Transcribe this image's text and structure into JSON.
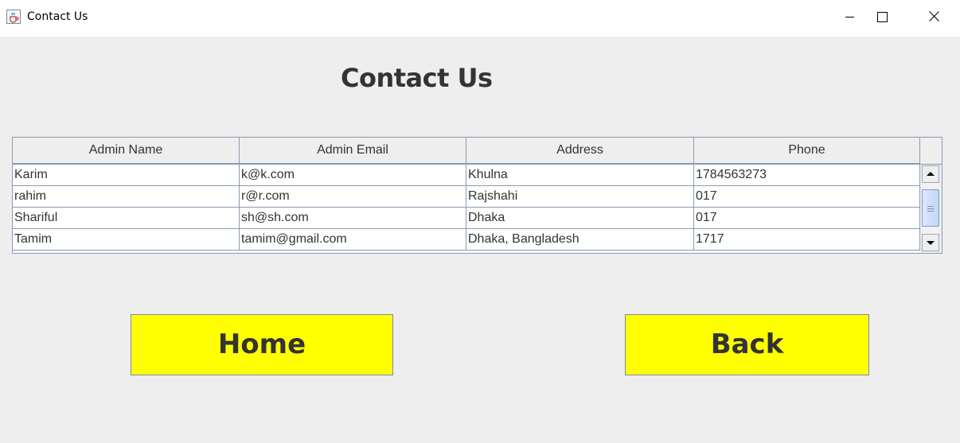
{
  "window": {
    "title": "Contact Us",
    "icons": {
      "app": "java-coffee-cup-icon",
      "minimize": "minimize-icon",
      "maximize": "maximize-icon",
      "close": "close-icon"
    }
  },
  "page": {
    "heading": "Contact Us"
  },
  "table": {
    "columns": [
      "Admin Name",
      "Admin Email",
      "Address",
      "Phone"
    ],
    "rows": [
      [
        "Karim",
        "k@k.com",
        "Khulna",
        "1784563273"
      ],
      [
        "rahim",
        "r@r.com",
        "Rajshahi",
        "017"
      ],
      [
        "Shariful",
        "sh@sh.com",
        "Dhaka",
        "017"
      ],
      [
        "Tamim",
        "tamim@gmail.com",
        "Dhaka, Bangladesh",
        "1717"
      ]
    ],
    "scrollbar": {
      "up_icon": "arrow-up-icon",
      "down_icon": "arrow-down-icon",
      "thumb_icon": "grip-lines-icon",
      "visible_fraction": 0.73,
      "position_fraction": 0.45
    }
  },
  "buttons": {
    "home_label": "Home",
    "back_label": "Back"
  },
  "colors": {
    "button_background": "#ffff00",
    "panel_background": "#eeeeee",
    "grid_lines": "#8a9ab4",
    "text": "#333333"
  }
}
